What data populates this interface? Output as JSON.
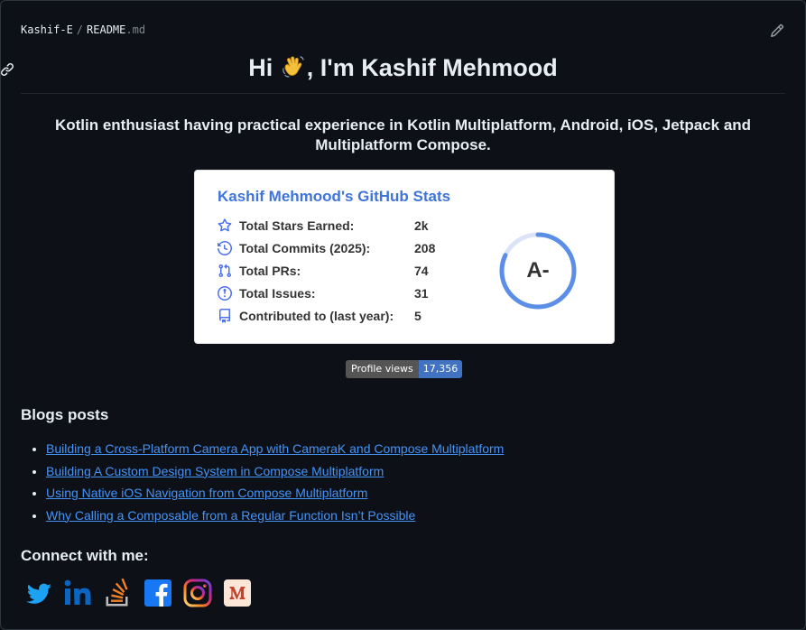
{
  "breadcrumb": {
    "owner": "Kashif-E",
    "separator": "/",
    "file_name": "README",
    "file_ext": ".md"
  },
  "heading": {
    "pre": "Hi ",
    "post": ", I'm Kashif Mehmood"
  },
  "intro": "Kotlin enthusiast having practical experience in Kotlin Multiplatform, Android, iOS, Jetpack and Multiplatform Compose.",
  "stats_card": {
    "title": "Kashif Mehmood's GitHub Stats",
    "rows": [
      {
        "icon": "star-icon",
        "label": "Total Stars Earned:",
        "value": "2k"
      },
      {
        "icon": "history-icon",
        "label": "Total Commits (2025):",
        "value": "208"
      },
      {
        "icon": "pull-request-icon",
        "label": "Total PRs:",
        "value": "74"
      },
      {
        "icon": "issue-icon",
        "label": "Total Issues:",
        "value": "31"
      },
      {
        "icon": "repo-icon",
        "label": "Contributed to (last year):",
        "value": "5"
      }
    ],
    "rank": "A-",
    "rank_progress": 0.82,
    "title_color": "#3f74d8",
    "icon_color": "#4c71f2",
    "ring_color": "#5b8ee6"
  },
  "profile_views": {
    "label": "Profile views",
    "count": "17,356",
    "color": "#4272c2"
  },
  "blogs": {
    "heading": "Blogs posts",
    "items": [
      "Building a Cross-Platform Camera App with CameraK and Compose Multiplatform",
      "Building A Custom Design System in Compose Multiplatform",
      "Using Native iOS Navigation from Compose Multiplatform",
      "Why Calling a Composable from a Regular Function Isn’t Possible"
    ]
  },
  "connect": {
    "heading": "Connect with me:",
    "icons": [
      "twitter-icon",
      "linkedin-icon",
      "stackoverflow-icon",
      "facebook-icon",
      "instagram-icon",
      "medium-icon"
    ]
  }
}
